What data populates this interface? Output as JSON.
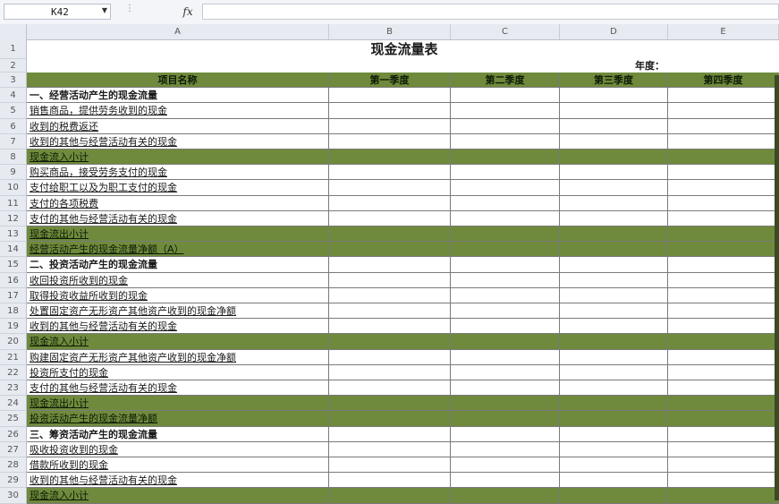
{
  "formula_bar": {
    "cell_ref": "K42",
    "fx": "fx",
    "formula": ""
  },
  "columns": [
    "A",
    "B",
    "C",
    "D",
    "E"
  ],
  "sheet": {
    "title": "现金流量表",
    "year_label": "年度：",
    "header_item": "项目名称",
    "quarters": [
      "第一季度",
      "第二季度",
      "第三季度",
      "第四季度"
    ],
    "rows": [
      {
        "n": "1",
        "type": "title"
      },
      {
        "n": "2",
        "type": "year"
      },
      {
        "n": "3",
        "type": "header"
      },
      {
        "n": "4",
        "type": "section",
        "label": "一、经营活动产生的现金流量"
      },
      {
        "n": "5",
        "type": "item",
        "label": "销售商品，提供劳务收到的现金"
      },
      {
        "n": "6",
        "type": "item",
        "label": "收到的税费返还"
      },
      {
        "n": "7",
        "type": "item",
        "label": "收到的其他与经营活动有关的现金"
      },
      {
        "n": "8",
        "type": "subtotal",
        "label": "现金流入小计"
      },
      {
        "n": "9",
        "type": "item",
        "label": "购买商品，接受劳务支付的现金"
      },
      {
        "n": "10",
        "type": "item",
        "label": "支付给职工以及为职工支付的现金"
      },
      {
        "n": "11",
        "type": "item",
        "label": "支付的各项税费"
      },
      {
        "n": "12",
        "type": "item",
        "label": "支付的其他与经营活动有关的现金"
      },
      {
        "n": "13",
        "type": "subtotal",
        "label": "现金流出小计"
      },
      {
        "n": "14",
        "type": "subtotal",
        "label": "经营活动产生的现金流量净额（A）"
      },
      {
        "n": "15",
        "type": "section",
        "label": "二、投资活动产生的现金流量"
      },
      {
        "n": "16",
        "type": "item",
        "label": "收回投资所收到的现金"
      },
      {
        "n": "17",
        "type": "item",
        "label": "取得投资收益所收到的现金"
      },
      {
        "n": "18",
        "type": "item",
        "label": "处置固定资产无形资产其他资产收到的现金净额"
      },
      {
        "n": "19",
        "type": "item",
        "label": "收到的其他与经营活动有关的现金"
      },
      {
        "n": "20",
        "type": "subtotal",
        "label": "现金流入小计"
      },
      {
        "n": "21",
        "type": "item",
        "label": "购建固定资产无形资产其他资产收到的现金净额"
      },
      {
        "n": "22",
        "type": "item",
        "label": "投资所支付的现金"
      },
      {
        "n": "23",
        "type": "item",
        "label": "支付的其他与经营活动有关的现金"
      },
      {
        "n": "24",
        "type": "subtotal",
        "label": "现金流出小计"
      },
      {
        "n": "25",
        "type": "subtotal",
        "label": "投资活动产生的现金流量净额"
      },
      {
        "n": "26",
        "type": "section",
        "label": "三、筹资活动产生的现金流量"
      },
      {
        "n": "27",
        "type": "item",
        "label": "吸收投资收到的现金"
      },
      {
        "n": "28",
        "type": "item",
        "label": "借款所收到的现金"
      },
      {
        "n": "29",
        "type": "item",
        "label": "收到的其他与经营活动有关的现金"
      },
      {
        "n": "30",
        "type": "subtotal",
        "label": "现金流入小计"
      }
    ]
  }
}
